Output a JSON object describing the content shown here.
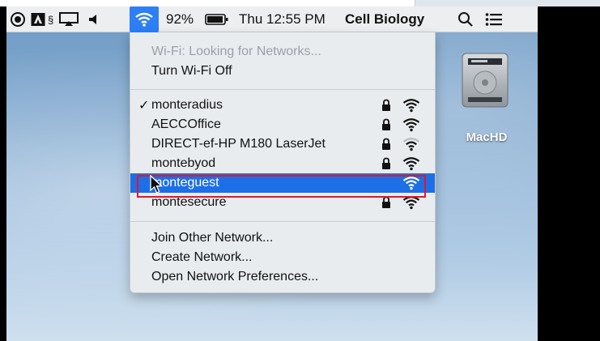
{
  "menubar": {
    "battery_percent": "92%",
    "clock": "Thu 12:55 PM",
    "user_name": "Cell Biology",
    "icons": [
      "record-icon",
      "adobe-icon",
      "airplay-icon",
      "volume-icon",
      "wifi-icon",
      "battery-icon",
      "search-icon",
      "list-icon"
    ],
    "adobe_suffix": "§"
  },
  "wifi_menu": {
    "status": "Wi-Fi: Looking for Networks...",
    "toggle_label": "Turn Wi-Fi Off",
    "networks": [
      {
        "name": "monteradius",
        "connected": true,
        "locked": true
      },
      {
        "name": "AECCOffice",
        "connected": false,
        "locked": true
      },
      {
        "name": "DIRECT-ef-HP M180 LaserJet",
        "connected": false,
        "locked": true
      },
      {
        "name": "montebyod",
        "connected": false,
        "locked": true
      },
      {
        "name": "monteguest",
        "connected": false,
        "locked": false,
        "selected": true
      },
      {
        "name": "montesecure",
        "connected": false,
        "locked": true
      }
    ],
    "actions": {
      "join_other": "Join Other Network...",
      "create": "Create Network...",
      "preferences": "Open Network Preferences..."
    },
    "check_mark": "✓"
  },
  "desktop": {
    "drive_label": "MacHD"
  },
  "colors": {
    "menu_highlight": "#1d6fe6",
    "selection_outline": "#e3162b",
    "menubar_wifi": "#2d7ff5"
  }
}
